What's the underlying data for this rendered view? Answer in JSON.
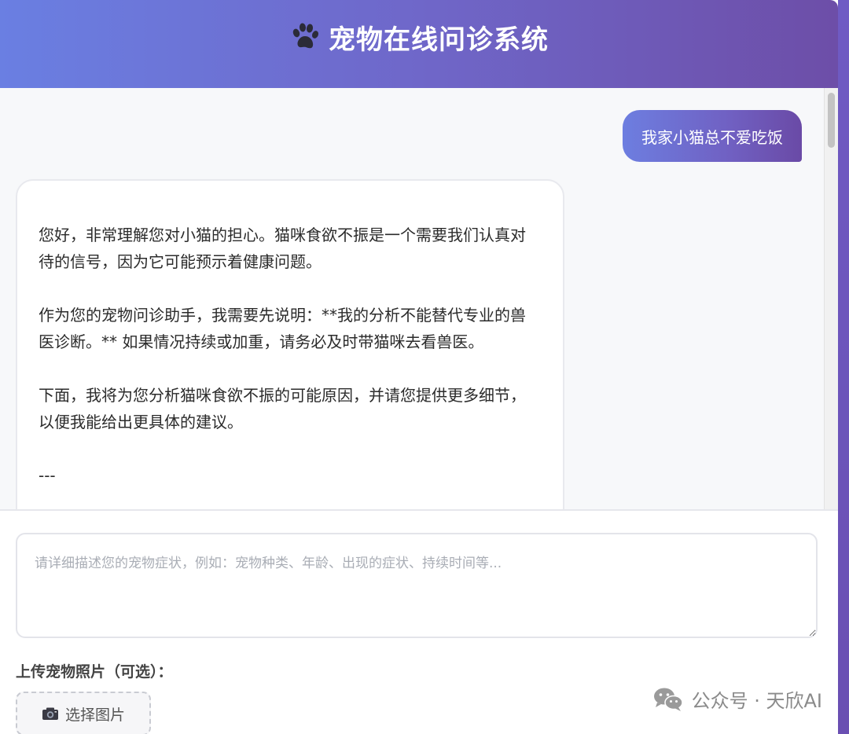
{
  "header": {
    "title": "宠物在线问诊系统",
    "icon": "paw-icon"
  },
  "chat": {
    "user_message": "我家小猫总不爱吃饭",
    "bot_paragraphs": [
      "您好，非常理解您对小猫的担心。猫咪食欲不振是一个需要我们认真对待的信号，因为它可能预示着健康问题。",
      "作为您的宠物问诊助手，我需要先说明：**我的分析不能替代专业的兽医诊断。** 如果情况持续或加重，请务必及时带猫咪去看兽医。",
      "下面，我将为您分析猫咪食欲不振的可能原因，并请您提供更多细节，以便我能给出更具体的建议。",
      "---"
    ]
  },
  "input": {
    "placeholder": "请详细描述您的宠物症状，例如：宠物种类、年龄、出现的症状、持续时间等...",
    "value": ""
  },
  "upload": {
    "label": "上传宠物照片（可选）：",
    "button_label": "选择图片",
    "button_icon": "camera-icon"
  },
  "watermark": {
    "text": "公众号 · 天欣AI",
    "icon": "wechat-icon"
  },
  "colors": {
    "header_start": "#6a7fe2",
    "header_end": "#6d4ea8",
    "bubble_text": "#ffffff"
  }
}
